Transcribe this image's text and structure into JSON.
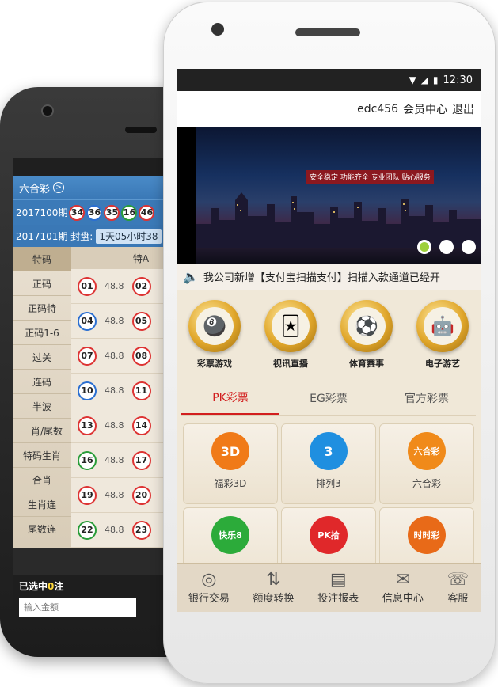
{
  "back_phone": {
    "title": "六合彩",
    "title_icon": ">",
    "draw_label": "2017100期",
    "balls": [
      {
        "n": "34",
        "c": "red"
      },
      {
        "n": "36",
        "c": "blue"
      },
      {
        "n": "35",
        "c": "red"
      },
      {
        "n": "16",
        "c": "green"
      },
      {
        "n": "46",
        "c": "red"
      }
    ],
    "next_draw": "2017101期 封盘:",
    "countdown": "1天05小时38",
    "side_menu": [
      "特码",
      "正码",
      "正码特",
      "正码1-6",
      "过关",
      "连码",
      "半波",
      "一肖/尾数",
      "特码生肖",
      "合肖",
      "生肖连",
      "尾数连"
    ],
    "table_header": "特A",
    "rows": [
      {
        "a": "01",
        "odds": "48.8",
        "b": "02"
      },
      {
        "a": "04",
        "odds": "48.8",
        "b": "05"
      },
      {
        "a": "07",
        "odds": "48.8",
        "b": "08"
      },
      {
        "a": "10",
        "odds": "48.8",
        "b": "11"
      },
      {
        "a": "13",
        "odds": "48.8",
        "b": "14"
      },
      {
        "a": "16",
        "odds": "48.8",
        "b": "17"
      },
      {
        "a": "19",
        "odds": "48.8",
        "b": "20"
      },
      {
        "a": "22",
        "odds": "48.8",
        "b": "23"
      }
    ],
    "selected_prefix": "已选中",
    "selected_count": "0",
    "selected_suffix": "注",
    "amount_placeholder": "输入金额"
  },
  "front_phone": {
    "status_time": "12:30",
    "user": "edc456",
    "member_center": "会员中心",
    "logout": "退出",
    "banner_slogan": "安全稳定 功能齐全 专业团队 贴心服务",
    "notice": "我公司新增【支付宝扫描支付】扫描入款通道已经开",
    "categories": [
      {
        "label": "彩票游戏",
        "icon": "lottery-icon",
        "glyph": "🎱"
      },
      {
        "label": "视讯直播",
        "icon": "cards-icon",
        "glyph": "🃏"
      },
      {
        "label": "体育赛事",
        "icon": "soccer-icon",
        "glyph": "⚽"
      },
      {
        "label": "电子游艺",
        "icon": "robot-icon",
        "glyph": "🤖"
      }
    ],
    "tabs": [
      "PK彩票",
      "EG彩票",
      "官方彩票"
    ],
    "games": [
      {
        "label": "福彩3D",
        "badge": "3D",
        "color": "#f07a18"
      },
      {
        "label": "排列3",
        "badge": "3",
        "color": "#1f8fe0"
      },
      {
        "label": "六合彩",
        "badge": "六合彩",
        "color": "#f08a1a"
      },
      {
        "label": "",
        "badge": "快乐8",
        "color": "#2cab3a"
      },
      {
        "label": "",
        "badge": "PK拾",
        "color": "#e0282a"
      },
      {
        "label": "",
        "badge": "时时彩",
        "color": "#e86a18"
      }
    ],
    "bottom_nav": [
      {
        "label": "银行交易",
        "icon": "coins-icon",
        "glyph": "◎"
      },
      {
        "label": "额度转换",
        "icon": "transfer-icon",
        "glyph": "⇅"
      },
      {
        "label": "投注报表",
        "icon": "report-icon",
        "glyph": "▤"
      },
      {
        "label": "信息中心",
        "icon": "mail-icon",
        "glyph": "✉"
      },
      {
        "label": "客服",
        "icon": "support-icon",
        "glyph": "☏"
      }
    ]
  }
}
